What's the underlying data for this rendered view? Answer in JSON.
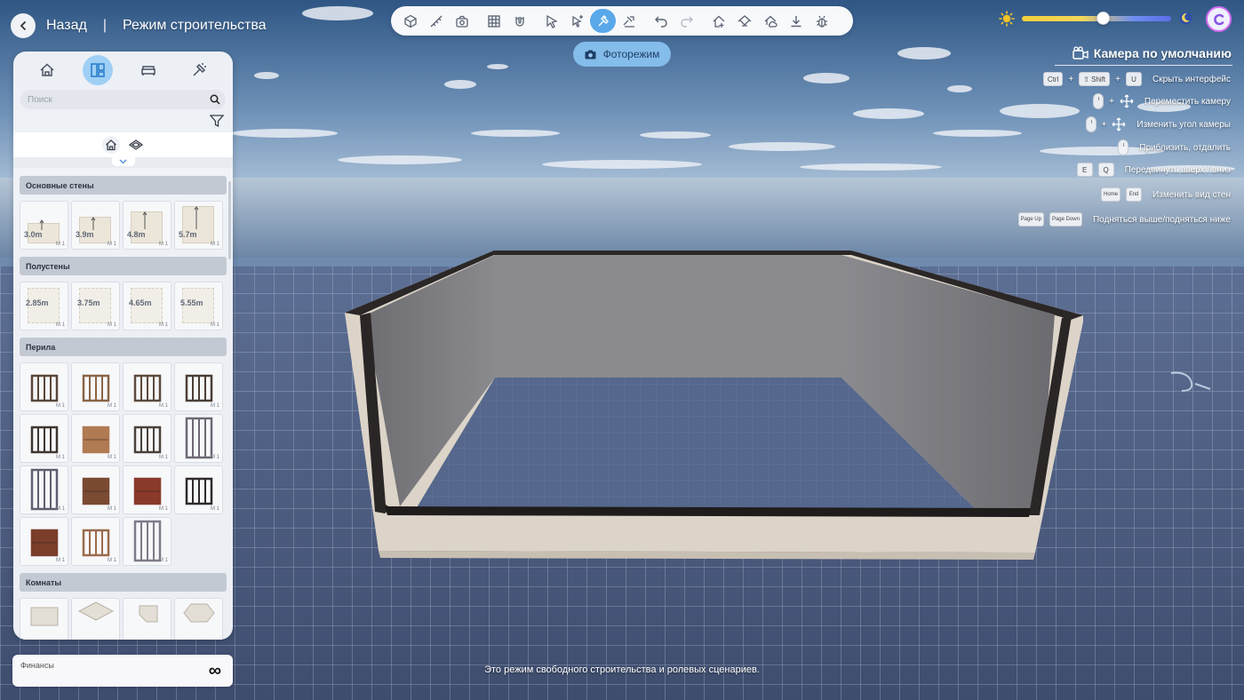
{
  "nav": {
    "back_label": "Назад",
    "separator": "|",
    "mode_title": "Режим строительства"
  },
  "toolbar": {
    "tools": [
      {
        "icon": "cube-icon",
        "active": false
      },
      {
        "icon": "measure-icon",
        "active": false
      },
      {
        "icon": "camera-move-icon",
        "active": false
      },
      {
        "icon": "grid-icon",
        "active": false
      },
      {
        "icon": "magnet-icon",
        "active": false
      },
      {
        "icon": "cursor-icon",
        "active": false
      },
      {
        "icon": "cursor-plus-icon",
        "active": false
      },
      {
        "icon": "hammer-icon",
        "active": true
      },
      {
        "icon": "build-tool-icon",
        "active": false
      },
      {
        "icon": "undo-icon",
        "active": false
      },
      {
        "icon": "redo-icon",
        "active": false
      },
      {
        "icon": "house-add-icon",
        "active": false
      },
      {
        "icon": "roof-icon",
        "active": false
      },
      {
        "icon": "house-cloud-icon",
        "active": false
      },
      {
        "icon": "download-icon",
        "active": false
      },
      {
        "icon": "bug-icon",
        "active": false
      }
    ]
  },
  "photo_mode": {
    "label": "Фоторежим"
  },
  "camera": {
    "title": "Камера по умолчанию",
    "hints": [
      {
        "keys": [
          "Ctrl",
          "+",
          "⇧ Shift",
          "+",
          "U"
        ],
        "text": "Скрыть интерфейс"
      },
      {
        "keys": [
          "mouse",
          "+",
          "move"
        ],
        "text": "Переместить камеру"
      },
      {
        "keys": [
          "mouse",
          "+",
          "move"
        ],
        "text": "Изменить угол камеры"
      },
      {
        "keys": [
          "mouse"
        ],
        "text": "Приблизить, отдалить"
      },
      {
        "keys": [
          "E",
          "Q"
        ],
        "text": "Передвинуть вверх / вниз"
      },
      {
        "keys": [
          "Home",
          "End"
        ],
        "text": "Изменить вид стен"
      },
      {
        "keys": [
          "Page Up",
          "Page Down"
        ],
        "text": "Подняться выше/подняться ниже"
      }
    ]
  },
  "time_slider": {
    "value": 0.54
  },
  "left_panel": {
    "search_placeholder": "Поиск",
    "sections": [
      {
        "title": "Основные стены",
        "items": [
          "3.0m",
          "3.9m",
          "4.8m",
          "5.7m"
        ]
      },
      {
        "title": "Полустены",
        "items": [
          "2.85m",
          "3.75m",
          "4.65m",
          "5.55m"
        ]
      },
      {
        "title": "Перила",
        "items": [
          "",
          "",
          "",
          "",
          "",
          "",
          "",
          "",
          "",
          "",
          "",
          "",
          "",
          "",
          ""
        ]
      },
      {
        "title": "Комнаты",
        "items": [
          "",
          "",
          "",
          ""
        ]
      }
    ],
    "item_badge": "M 1"
  },
  "finance": {
    "label": "Финансы",
    "value": "∞"
  },
  "footer": {
    "message": "Это режим свободного строительства и ролевых сценариев."
  },
  "colors": {
    "accent": "#5aa8ea",
    "panel_bg": "#f2f4f8",
    "section_header": "#c3c9d3"
  }
}
